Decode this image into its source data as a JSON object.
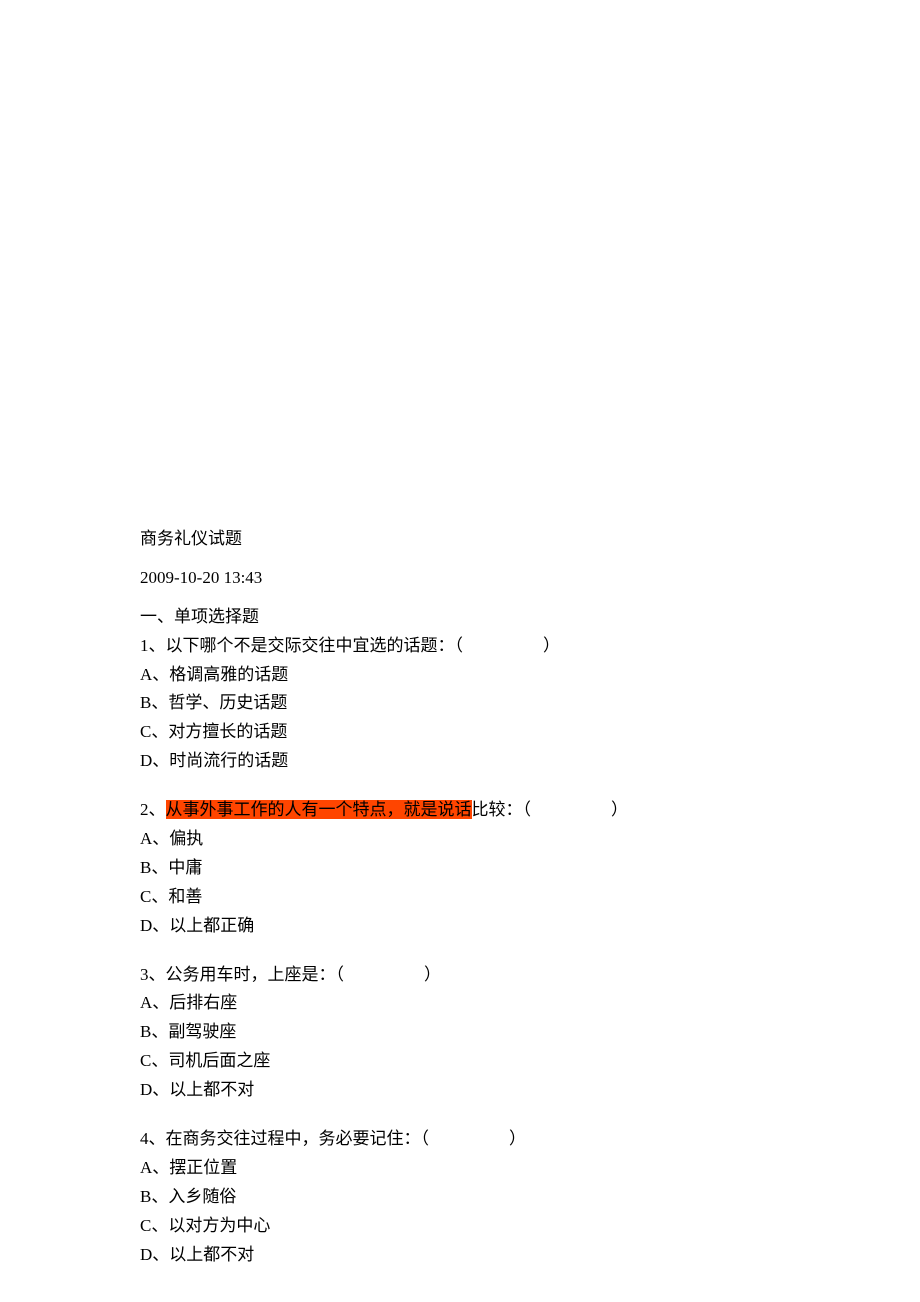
{
  "title": "商务礼仪试题",
  "timestamp": "2009-10-20 13:43",
  "section_header": "一、单项选择题",
  "questions": [
    {
      "number": "1、",
      "text": "以下哪个不是交际交往中宜选的话题：（",
      "text_end": "）",
      "options": {
        "A": "A、格调高雅的话题",
        "B": "B、哲学、历史话题",
        "C": "C、对方擅长的话题",
        "D": "D、时尚流行的话题"
      }
    },
    {
      "number": "2、",
      "highlighted": "从事外事工作的人有一个特点，就是说话",
      "text_after_highlight": "比较：（",
      "text_end": "）",
      "options": {
        "A": "A、偏执",
        "B": "B、中庸",
        "C": "C、和善",
        "D": "D、以上都正确"
      }
    },
    {
      "number": "3、",
      "text": "公务用车时，上座是：（",
      "text_end": "）",
      "options": {
        "A": "A、后排右座",
        "B": "B、副驾驶座",
        "C": "C、司机后面之座",
        "D": "D、以上都不对"
      }
    },
    {
      "number": "4、",
      "text": "在商务交往过程中，务必要记住：（",
      "text_end": "）",
      "options": {
        "A": "A、摆正位置",
        "B": "B、入乡随俗",
        "C": "C、以对方为中心",
        "D": "D、以上都不对"
      }
    }
  ]
}
